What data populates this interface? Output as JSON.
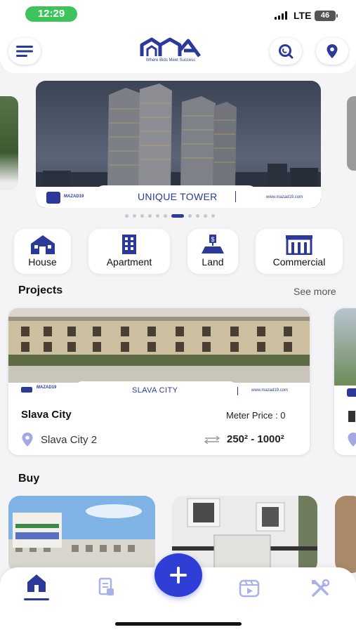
{
  "status_bar": {
    "time": "12:29",
    "network": "LTE",
    "battery": "46"
  },
  "header": {
    "tagline": "Where Bids Meet Success"
  },
  "banner": {
    "brand": "MAZAD19",
    "title": "UNIQUE TOWER",
    "url": "www.mazad19.com",
    "dot_count": 11,
    "active_dot": 6
  },
  "categories": [
    {
      "label": "House",
      "icon": "house-icon"
    },
    {
      "label": "Apartment",
      "icon": "apartment-building-icon"
    },
    {
      "label": "Land",
      "icon": "land-icon"
    },
    {
      "label": "Commercial",
      "icon": "commercial-building-icon"
    }
  ],
  "projects_section": {
    "title": "Projects",
    "see_more": "See more"
  },
  "project_card": {
    "brand": "MAZAD19",
    "banner_title": "SLAVA CITY",
    "banner_url": "www.mazad19.com",
    "name": "Slava City",
    "meter_price": "Meter Price : 0",
    "location": "Slava City 2",
    "area_range": "250² - 1000²"
  },
  "buy_section": {
    "title": "Buy"
  },
  "bottom_nav": {
    "items": [
      "home-icon",
      "document-icon",
      "add-icon",
      "video-icon",
      "tools-icon"
    ],
    "active": "home-icon"
  },
  "colors": {
    "brand": "#2b3a9a",
    "fab": "#2f3fd6",
    "status_pill": "#3cc35b"
  }
}
